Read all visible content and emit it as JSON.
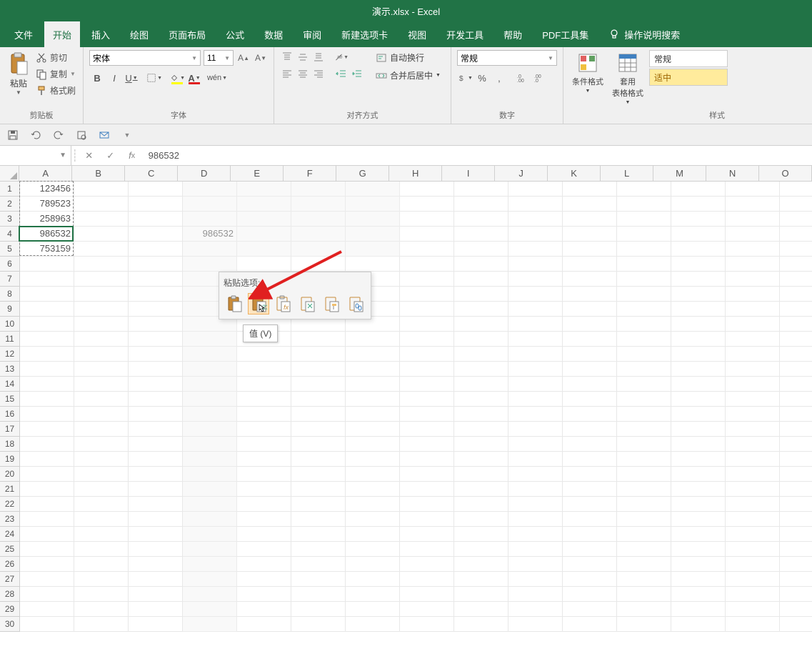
{
  "title": "演示.xlsx  -  Excel",
  "tabs": {
    "file": "文件",
    "home": "开始",
    "insert": "插入",
    "draw": "绘图",
    "page_layout": "页面布局",
    "formulas": "公式",
    "data": "数据",
    "review": "审阅",
    "new_tab": "新建选项卡",
    "view": "视图",
    "developer": "开发工具",
    "help": "帮助",
    "pdf": "PDF工具集",
    "tell_me": "操作说明搜索"
  },
  "clipboard": {
    "paste": "粘贴",
    "cut": "剪切",
    "copy": "复制",
    "format_painter": "格式刷",
    "group_label": "剪贴板"
  },
  "font": {
    "name": "宋体",
    "size": "11",
    "group_label": "字体"
  },
  "alignment": {
    "wrap": "自动换行",
    "merge": "合并后居中",
    "group_label": "对齐方式"
  },
  "number": {
    "format": "常规",
    "group_label": "数字"
  },
  "styles": {
    "conditional": "条件格式",
    "format_table": "套用\n表格格式",
    "normal": "常规",
    "good": "适中",
    "group_label": "样式"
  },
  "formula_bar": {
    "value": "986532"
  },
  "columns": [
    "A",
    "B",
    "C",
    "D",
    "E",
    "F",
    "G",
    "H",
    "I",
    "J",
    "K",
    "L",
    "M",
    "N",
    "O"
  ],
  "rows_count": 30,
  "cell_data": {
    "A1": "123456",
    "A2": "789523",
    "A3": "258963",
    "A4": "986532",
    "A5": "753159",
    "D4": "986532"
  },
  "paste_options": {
    "title": "粘贴选项:",
    "tooltip": "值 (V)",
    "items": [
      "paste-all",
      "paste-values",
      "paste-formulas",
      "paste-transpose",
      "paste-formatting",
      "paste-link"
    ]
  }
}
